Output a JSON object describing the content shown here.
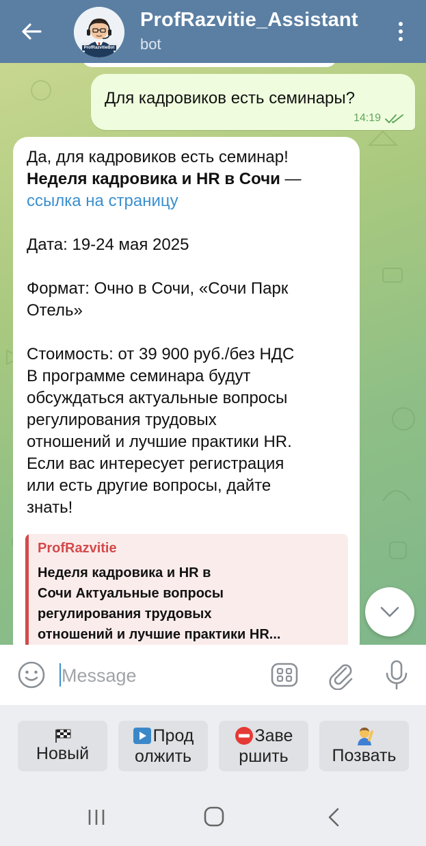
{
  "header": {
    "title": "ProfRazvitie_Assistant",
    "subtitle": "bot",
    "avatar_caption": "ProfRazvitieBot"
  },
  "messages": {
    "outgoing": {
      "text": "Для кадровиков есть семинары?",
      "time": "14:19"
    },
    "incoming": {
      "line1": "Да, для кадровиков есть семинар!",
      "event_name": "Неделя кадровика и HR в Сочи",
      "dash": " — ",
      "link_text": "ссылка на страницу",
      "date": "Дата: 19-24 мая 2025",
      "format_line1": "Формат: Очно в Сочи, «Сочи Парк",
      "format_line2": "Отель»",
      "cost": "Стоимость: от 39 900 руб./без НДС",
      "body1": "В программе семинара будут",
      "body2": "обсуждаться актуальные вопросы",
      "body3": "регулирования трудовых",
      "body4": "отношений и лучшие практики HR.",
      "body5": "Если вас интересует регистрация",
      "body6": "или есть другие вопросы, дайте",
      "body7": "знать!",
      "preview": {
        "site": "ProfRazvitie",
        "line1": "Неделя кадровика и HR в",
        "line2": "Сочи Актуальные вопросы",
        "line3": "регулирования трудовых",
        "line4": "отношений и лучшие практики HR..."
      }
    }
  },
  "input": {
    "placeholder": "Message"
  },
  "keyboard": {
    "buttons": [
      {
        "icon": "checkered-flag",
        "line1": "",
        "line2": "Новый"
      },
      {
        "icon": "play-button",
        "line1": "Прод",
        "line2": "олжить"
      },
      {
        "icon": "no-entry",
        "line1": "Заве",
        "line2": "ршить"
      },
      {
        "icon": "person-raising-hand",
        "line1": "",
        "line2": "Позвать"
      }
    ]
  },
  "colors": {
    "header_bg": "#5b7fa3",
    "outgoing_bubble": "#effdde",
    "link": "#3a8fd0",
    "preview_accent": "#d24a4a"
  }
}
